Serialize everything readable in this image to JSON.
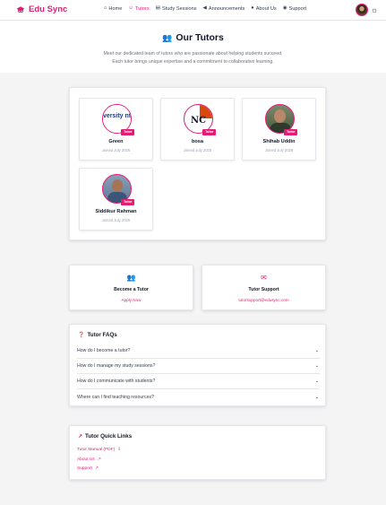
{
  "app": {
    "name": "Edu Sync",
    "accent": "#e11d74"
  },
  "nav": {
    "items": [
      {
        "label": "Home",
        "icon": "home-icon"
      },
      {
        "label": "Tutors",
        "icon": "tutor-icon",
        "active": true
      },
      {
        "label": "Study Sessions",
        "icon": "book-icon"
      },
      {
        "label": "Announcements",
        "icon": "megaphone-icon"
      },
      {
        "label": "About Us",
        "icon": "info-icon"
      },
      {
        "label": "Support",
        "icon": "support-icon"
      }
    ]
  },
  "hero": {
    "title": "Our Tutors",
    "subtitle_line1": "Meet our dedicated team of tutors who are passionate about helping students succeed.",
    "subtitle_line2": "Each tutor brings unique expertise and a commitment to collaborative learning."
  },
  "tutors": [
    {
      "name": "Green",
      "badge": "Tutor",
      "joined": "Joined July 2025",
      "photo_text": "versity ntral La"
    },
    {
      "name": "bosa",
      "badge": "Tutor",
      "joined": "Joined July 2025",
      "photo_text": "NC"
    },
    {
      "name": "Shihab Uddin",
      "badge": "Tutor",
      "joined": "Joined July 2025"
    },
    {
      "name": "Siddikur Rahman",
      "badge": "Tutor",
      "joined": "Joined July 2025"
    }
  ],
  "actions": {
    "become": {
      "title": "Become a Tutor",
      "link": "Apply Now"
    },
    "support": {
      "title": "Tutor Support",
      "link": "tutorsupport@edusync.com"
    }
  },
  "faq": {
    "title": "Tutor FAQs",
    "items": [
      "How do I become a tutor?",
      "How do I manage my study sessions?",
      "How do I communicate with students?",
      "Where can I find teaching resources?"
    ]
  },
  "quick_links": {
    "title": "Tutor Quick Links",
    "items": [
      "Tutor Manual (PDF)",
      "About Us",
      "Support"
    ]
  }
}
